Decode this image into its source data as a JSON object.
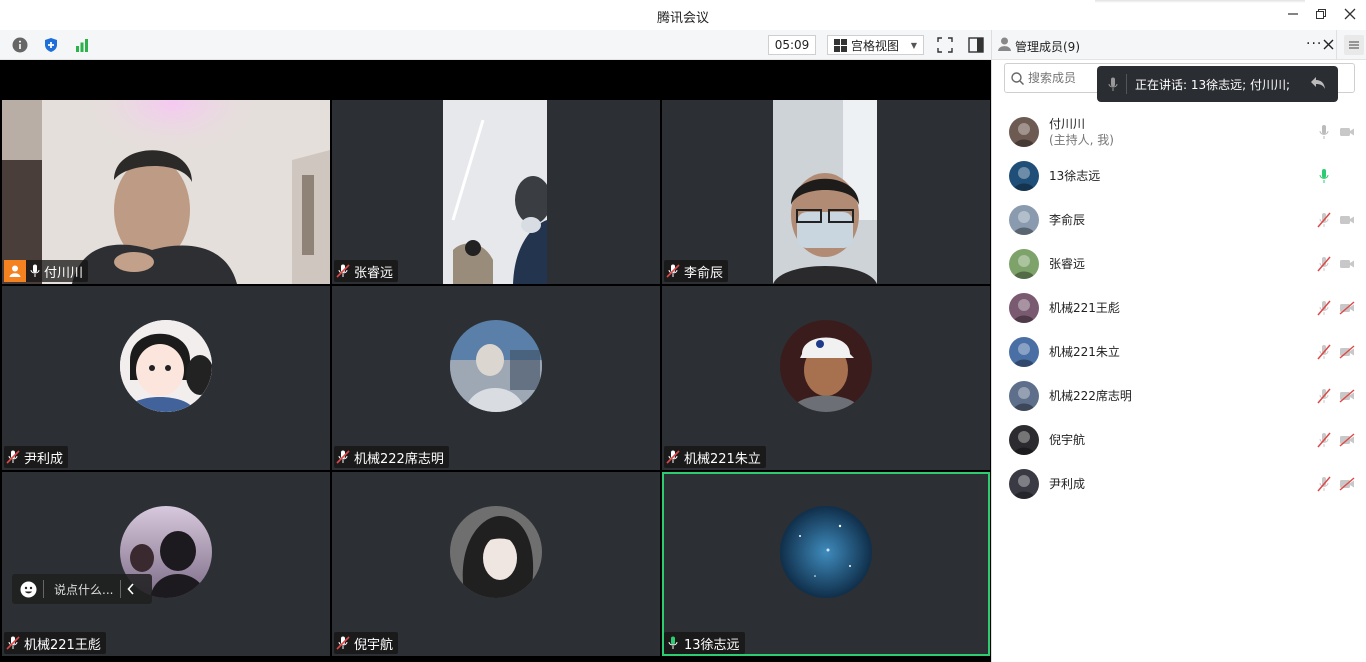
{
  "window": {
    "title": "腾讯会议"
  },
  "toolbar": {
    "timer": "05:09",
    "view_label": "宫格视图",
    "icons": [
      "info-icon",
      "shield-icon",
      "signal-icon",
      "fullscreen-icon",
      "sidebar-toggle-icon"
    ]
  },
  "tiles": [
    {
      "name": "付川川",
      "mic": "on",
      "host": true,
      "type": "camera"
    },
    {
      "name": "张睿远",
      "mic": "muted",
      "type": "camera"
    },
    {
      "name": "李俞辰",
      "mic": "muted",
      "type": "camera"
    },
    {
      "name": "尹利成",
      "mic": "muted",
      "type": "avatar"
    },
    {
      "name": "机械222席志明",
      "mic": "muted",
      "type": "avatar"
    },
    {
      "name": "机械221朱立",
      "mic": "muted",
      "type": "avatar"
    },
    {
      "name": "机械221王彪",
      "mic": "muted",
      "type": "avatar"
    },
    {
      "name": "倪宇航",
      "mic": "muted",
      "type": "avatar"
    },
    {
      "name": "13徐志远",
      "mic": "speaking",
      "type": "avatar",
      "active": true
    }
  ],
  "chat": {
    "placeholder": "说点什么..."
  },
  "panel": {
    "title": "管理成员(9)",
    "search_placeholder": "搜索成员",
    "speaking_text": "正在讲话: 13徐志远; 付川川;",
    "members": [
      {
        "name": "付川川",
        "sub": "(主持人, 我)",
        "mic": "on",
        "cam": "on"
      },
      {
        "name": "13徐志远",
        "sub": "",
        "mic": "speaking",
        "cam": "none"
      },
      {
        "name": "李俞辰",
        "sub": "",
        "mic": "muted",
        "cam": "on"
      },
      {
        "name": "张睿远",
        "sub": "",
        "mic": "muted",
        "cam": "on"
      },
      {
        "name": "机械221王彪",
        "sub": "",
        "mic": "muted",
        "cam": "off"
      },
      {
        "name": "机械221朱立",
        "sub": "",
        "mic": "muted",
        "cam": "off"
      },
      {
        "name": "机械222席志明",
        "sub": "",
        "mic": "muted",
        "cam": "off"
      },
      {
        "name": "倪宇航",
        "sub": "",
        "mic": "muted",
        "cam": "off"
      },
      {
        "name": "尹利成",
        "sub": "",
        "mic": "muted",
        "cam": "off"
      }
    ]
  },
  "colors": {
    "speaking": "#2ecc71",
    "muted": "#e04848",
    "host": "#f58220"
  }
}
